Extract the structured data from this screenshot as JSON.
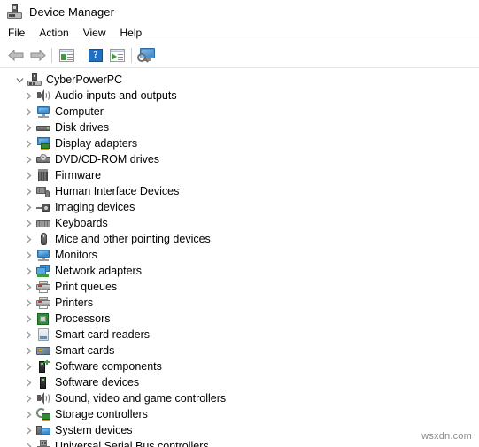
{
  "window": {
    "title": "Device Manager",
    "icon": "device-manager-icon"
  },
  "menubar": {
    "items": [
      {
        "label": "File"
      },
      {
        "label": "Action"
      },
      {
        "label": "View"
      },
      {
        "label": "Help"
      }
    ]
  },
  "toolbar": {
    "buttons": [
      {
        "name": "back-button",
        "icon": "back-arrow-icon",
        "tooltip": "Back"
      },
      {
        "name": "forward-button",
        "icon": "forward-arrow-icon",
        "tooltip": "Forward"
      },
      {
        "name": "properties-button",
        "icon": "properties-window-icon",
        "tooltip": "Properties"
      },
      {
        "name": "help-button",
        "icon": "help-question-icon",
        "tooltip": "Help"
      },
      {
        "name": "update-driver-button",
        "icon": "window-play-icon",
        "tooltip": "Update driver"
      },
      {
        "name": "scan-hardware-button",
        "icon": "scan-monitor-icon",
        "tooltip": "Scan for hardware changes"
      }
    ]
  },
  "tree": {
    "root": {
      "label": "CyberPowerPC",
      "icon": "computer-root-icon",
      "expanded": true,
      "chevron": "chevron-down-icon"
    },
    "children": [
      {
        "label": "Audio inputs and outputs",
        "icon": "speaker-icon"
      },
      {
        "label": "Computer",
        "icon": "monitor-icon"
      },
      {
        "label": "Disk drives",
        "icon": "disk-drive-icon"
      },
      {
        "label": "Display adapters",
        "icon": "display-adapter-icon"
      },
      {
        "label": "DVD/CD-ROM drives",
        "icon": "dvd-drive-icon"
      },
      {
        "label": "Firmware",
        "icon": "firmware-chip-icon"
      },
      {
        "label": "Human Interface Devices",
        "icon": "hid-keyboard-mouse-icon"
      },
      {
        "label": "Imaging devices",
        "icon": "imaging-camera-icon"
      },
      {
        "label": "Keyboards",
        "icon": "keyboard-icon"
      },
      {
        "label": "Mice and other pointing devices",
        "icon": "mouse-icon"
      },
      {
        "label": "Monitors",
        "icon": "monitor-icon"
      },
      {
        "label": "Network adapters",
        "icon": "network-adapter-icon"
      },
      {
        "label": "Print queues",
        "icon": "printer-icon"
      },
      {
        "label": "Printers",
        "icon": "printer-icon"
      },
      {
        "label": "Processors",
        "icon": "cpu-chip-icon"
      },
      {
        "label": "Smart card readers",
        "icon": "smart-card-reader-icon"
      },
      {
        "label": "Smart cards",
        "icon": "smart-card-icon"
      },
      {
        "label": "Software components",
        "icon": "software-component-icon"
      },
      {
        "label": "Software devices",
        "icon": "software-device-icon"
      },
      {
        "label": "Sound, video and game controllers",
        "icon": "speaker-icon"
      },
      {
        "label": "Storage controllers",
        "icon": "storage-controller-icon"
      },
      {
        "label": "System devices",
        "icon": "system-device-icon"
      },
      {
        "label": "Universal Serial Bus controllers",
        "icon": "usb-controller-icon"
      }
    ],
    "child_chevron": "chevron-right-icon"
  },
  "watermark": {
    "text": "wsxdn.com"
  },
  "colors": {
    "accent_blue": "#3b8fd4",
    "accent_green": "#2f8b3a",
    "help_blue": "#1f6fc4",
    "text": "#000000",
    "chevron": "#8a8a8a",
    "separator": "#e3e3e3",
    "background": "#ffffff"
  }
}
